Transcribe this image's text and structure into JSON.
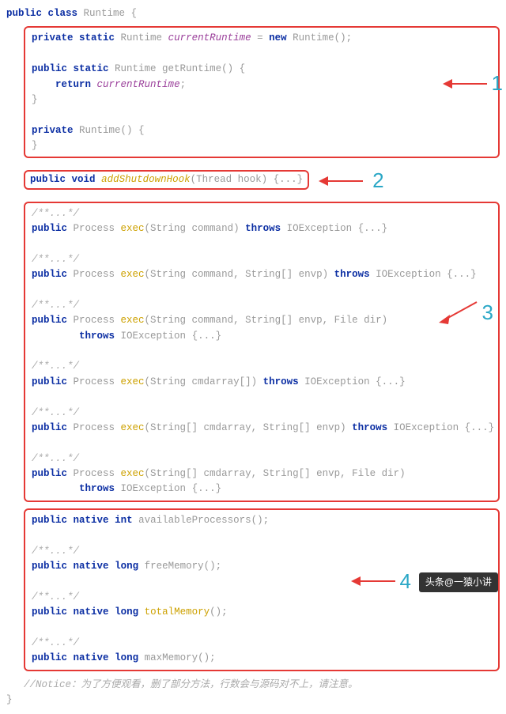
{
  "header": "public class Runtime {",
  "box1": {
    "l1": "private static Runtime currentRuntime = new Runtime();",
    "l2": "public static Runtime getRuntime() {",
    "l3": "    return currentRuntime;",
    "l4": "}",
    "l5": "private Runtime() {",
    "l6": "}"
  },
  "box2": {
    "l1_a": "public void ",
    "l1_fn": "addShutdownHook",
    "l1_b": "(Thread hook) ",
    "l1_fold": "{...}"
  },
  "box3": {
    "c": "/**...*/",
    "e1": "public Process exec(String command) throws IOException {...}",
    "e2": "public Process exec(String command, String[] envp) throws IOException {...}",
    "e3a": "public Process exec(String command, String[] envp, File dir)",
    "e3b": "        throws IOException {...}",
    "e4": "public Process exec(String cmdarray[]) throws IOException {...}",
    "e5": "public Process exec(String[] cmdarray, String[] envp) throws IOException {...}",
    "e6a": "public Process exec(String[] cmdarray, String[] envp, File dir)",
    "e6b": "        throws IOException {...}"
  },
  "box4": {
    "c": "/**...*/",
    "n1": "public native int availableProcessors();",
    "n2": "public native long freeMemory();",
    "n3": "public native long totalMemory();",
    "n4": "public native long maxMemory();"
  },
  "annot": {
    "a1": "1",
    "a2": "2",
    "a3": "3",
    "a4": "4"
  },
  "notice": "//Notice：为了方便观看，删了部分方法，行数会与源码对不上，请注意。",
  "closing": "}",
  "watermark": "头条@一猿小讲"
}
